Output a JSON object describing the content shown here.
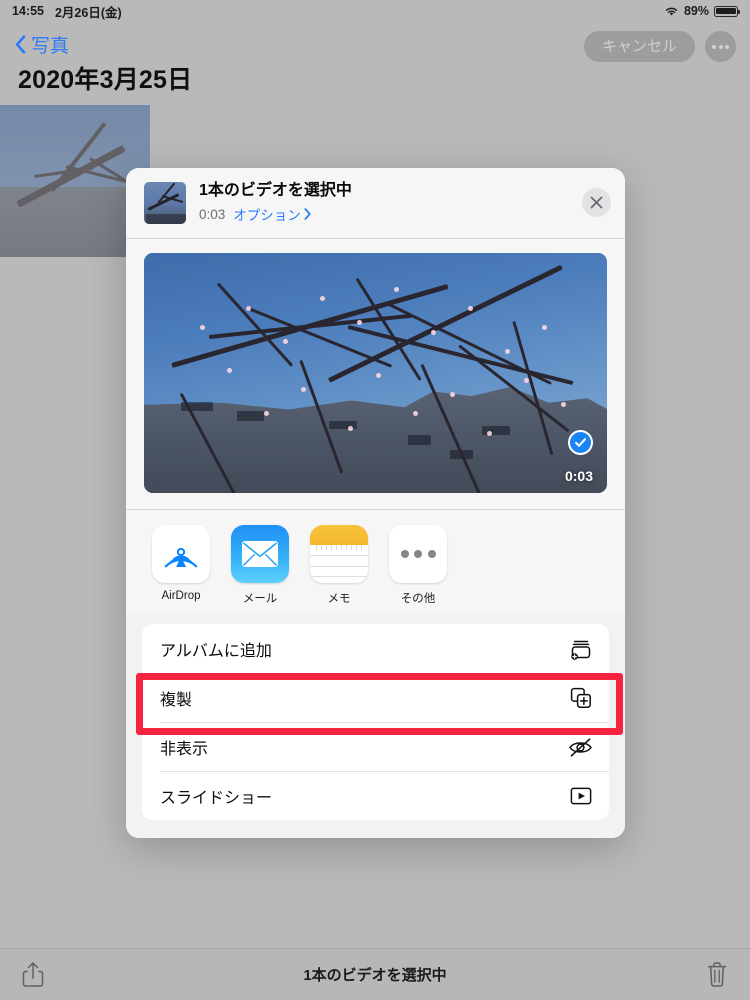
{
  "statusbar": {
    "time": "14:55",
    "date": "2月26日(金)",
    "wifi_icon": "wifi-icon",
    "battery_percent": "89%",
    "battery_level": 89,
    "battery_icon": "battery-icon"
  },
  "navbar": {
    "back_label": "写真",
    "back_icon": "chevron-left-icon",
    "cancel_label": "キャンセル",
    "more_icon": "ellipsis-icon"
  },
  "page": {
    "title": "2020年3月25日"
  },
  "share_sheet": {
    "header": {
      "thumbnail": "video-thumbnail",
      "title": "1本のビデオを選択中",
      "duration": "0:03",
      "options_label": "オプション",
      "options_chevron_icon": "chevron-right-icon",
      "close_icon": "close-icon"
    },
    "preview": {
      "duration": "0:03",
      "selected_icon": "checkmark-circle-icon",
      "selected": true
    },
    "apps": [
      {
        "label": "AirDrop",
        "icon": "airdrop-icon"
      },
      {
        "label": "メール",
        "icon": "mail-icon"
      },
      {
        "label": "メモ",
        "icon": "notes-icon"
      },
      {
        "label": "その他",
        "icon": "ellipsis-icon"
      }
    ],
    "actions": [
      {
        "label": "アルバムに追加",
        "icon": "add-to-album-icon",
        "highlighted": false
      },
      {
        "label": "複製",
        "icon": "duplicate-icon",
        "highlighted": true
      },
      {
        "label": "非表示",
        "icon": "hide-eye-slash-icon",
        "highlighted": false
      },
      {
        "label": "スライドショー",
        "icon": "slideshow-play-icon",
        "highlighted": false
      }
    ]
  },
  "highlight": {
    "color": "#f5243f",
    "target": "複製"
  },
  "bottom_toolbar": {
    "share_icon": "share-icon",
    "label": "1本のビデオを選択中",
    "trash_icon": "trash-icon"
  },
  "colors": {
    "accent_blue": "#2e7bf6",
    "background_gray": "#b9b9b9",
    "sheet_bg": "#f2f2f3",
    "highlight_red": "#f5243f"
  }
}
